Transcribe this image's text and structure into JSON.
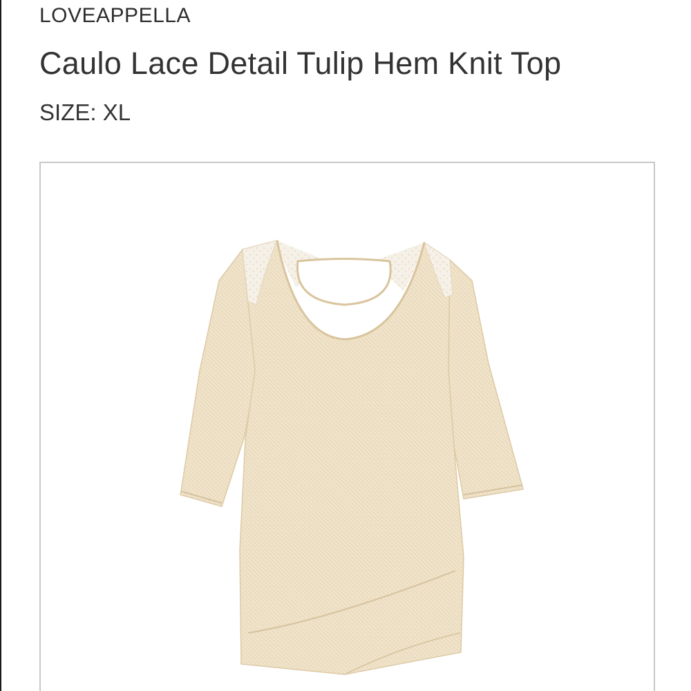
{
  "product": {
    "brand": "LOVEAPPELLA",
    "title": "Caulo Lace Detail Tulip Hem Knit Top",
    "size_label": "SIZE:",
    "size_value": "XL"
  },
  "image": {
    "icon": "knit-top-product-photo",
    "fabric_color": "#efe1c6",
    "lace_color": "#f6f1e8",
    "frame_border_color": "#c8c8c8"
  }
}
